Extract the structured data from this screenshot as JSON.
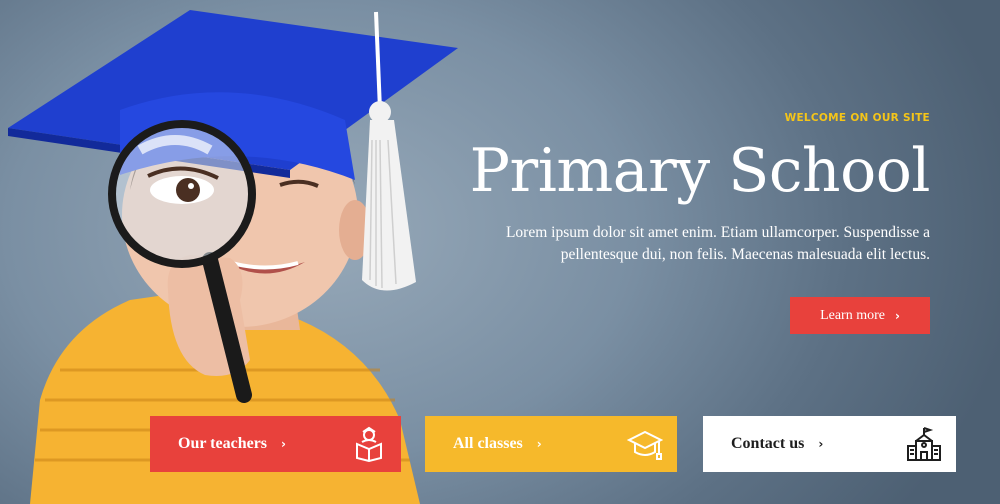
{
  "hero": {
    "welcome": "WELCOME ON OUR SITE",
    "title": "Primary School",
    "description": "Lorem ipsum dolor sit amet enim. Etiam ullamcorper. Suspendisse a pellentesque dui, non felis. Maecenas malesuada elit lectus.",
    "cta_label": "Learn more",
    "cta_chevron": "›"
  },
  "cards": {
    "teachers": {
      "label": "Our teachers",
      "chevron": "›",
      "icon": "student-at-desk-icon"
    },
    "classes": {
      "label": "All classes",
      "chevron": "›",
      "icon": "graduation-cap-icon"
    },
    "contact": {
      "label": "Contact us",
      "chevron": "›",
      "icon": "school-building-icon"
    }
  },
  "colors": {
    "accent_red": "#e8413c",
    "accent_yellow": "#f6b92b",
    "welcome_yellow": "#f5c518",
    "cap_blue": "#1f3fcf"
  }
}
